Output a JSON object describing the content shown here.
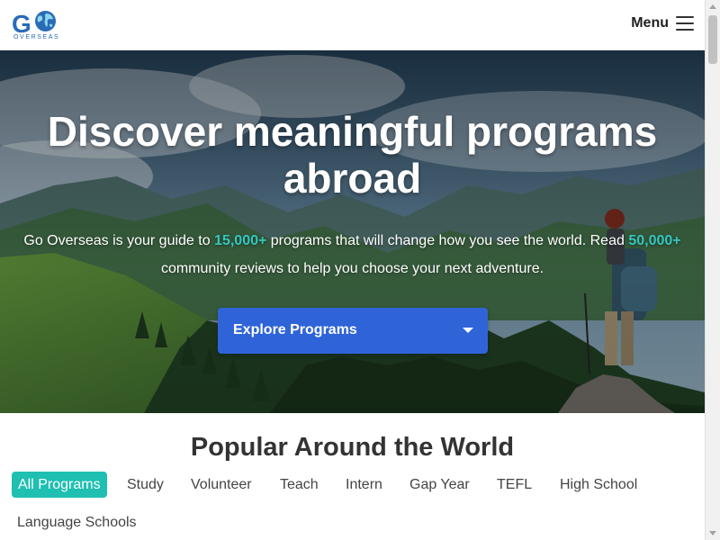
{
  "header": {
    "logo_text": "GO",
    "logo_subtext": "OVERSEAS",
    "menu_label": "Menu"
  },
  "hero": {
    "title": "Discover meaningful programs abroad",
    "desc_part1": "Go Overseas is your guide to ",
    "programs_count": "15,000+",
    "desc_part2": " programs that will change how you see the world. Read ",
    "reviews_count": "50,000+",
    "desc_part3": " community reviews to help you choose your next adventure.",
    "explore_label": "Explore Programs"
  },
  "popular": {
    "title": "Popular Around the World",
    "tabs": [
      {
        "label": "All Programs",
        "active": true
      },
      {
        "label": "Study"
      },
      {
        "label": "Volunteer"
      },
      {
        "label": "Teach"
      },
      {
        "label": "Intern"
      },
      {
        "label": "Gap Year"
      },
      {
        "label": "TEFL"
      },
      {
        "label": "High School"
      },
      {
        "label": "Language Schools"
      }
    ]
  },
  "colors": {
    "brand_blue": "#2a6bb8",
    "accent_teal": "#1fbfb1",
    "highlight_teal": "#35c6c0",
    "button_blue": "#2f64d8"
  },
  "icons": {
    "logo": "globe-icon",
    "menu": "hamburger-icon",
    "dropdown": "caret-down-icon"
  }
}
